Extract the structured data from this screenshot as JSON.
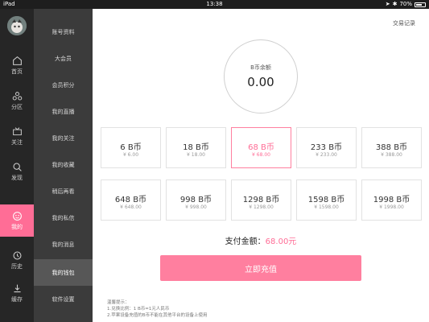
{
  "status_bar": {
    "device": "iPad",
    "time": "13:38",
    "battery_percent": "70%",
    "battery_level": 0.7
  },
  "rail": {
    "items": [
      {
        "label": "首页",
        "icon": "home-icon"
      },
      {
        "label": "分区",
        "icon": "category-icon"
      },
      {
        "label": "关注",
        "icon": "follow-icon"
      },
      {
        "label": "发现",
        "icon": "discover-icon"
      },
      {
        "label": "我的",
        "icon": "mine-icon",
        "active": true
      },
      {
        "label": "历史",
        "icon": "history-icon"
      },
      {
        "label": "缓存",
        "icon": "download-icon"
      }
    ]
  },
  "submenu": {
    "items": [
      {
        "label": "账号资料"
      },
      {
        "label": "大会员"
      },
      {
        "label": "会员积分"
      },
      {
        "label": "我的直播"
      },
      {
        "label": "我的关注"
      },
      {
        "label": "我的收藏"
      },
      {
        "label": "稍后再看"
      },
      {
        "label": "我的私信"
      },
      {
        "label": "我的消息"
      },
      {
        "label": "我的钱包",
        "active": true
      },
      {
        "label": "软件设置"
      }
    ]
  },
  "main": {
    "records_link": "交易记录",
    "balance": {
      "label": "B币余额",
      "value": "0.00"
    },
    "packages": [
      {
        "amount": "6 B币",
        "price": "¥ 6.00"
      },
      {
        "amount": "18 B币",
        "price": "¥ 18.00"
      },
      {
        "amount": "68 B币",
        "price": "¥ 68.00",
        "selected": true
      },
      {
        "amount": "233 B币",
        "price": "¥ 233.00"
      },
      {
        "amount": "388 B币",
        "price": "¥ 388.00"
      },
      {
        "amount": "648 B币",
        "price": "¥ 648.00"
      },
      {
        "amount": "998 B币",
        "price": "¥ 998.00"
      },
      {
        "amount": "1298 B币",
        "price": "¥ 1298.00"
      },
      {
        "amount": "1598 B币",
        "price": "¥ 1598.00"
      },
      {
        "amount": "1998 B币",
        "price": "¥ 1998.00"
      }
    ],
    "pay_total_label": "支付金额：",
    "pay_total_value": "68.00元",
    "recharge_button": "立即充值",
    "tips": [
      "温馨提示：",
      "1.兑换比例：1 B币=1元人民币",
      "2.苹果设备充值的B币不能在其他平台的设备上使用"
    ]
  },
  "colors": {
    "accent": "#ff6d96",
    "rail_bg": "#262626",
    "submenu_bg": "#3b3b3b"
  }
}
